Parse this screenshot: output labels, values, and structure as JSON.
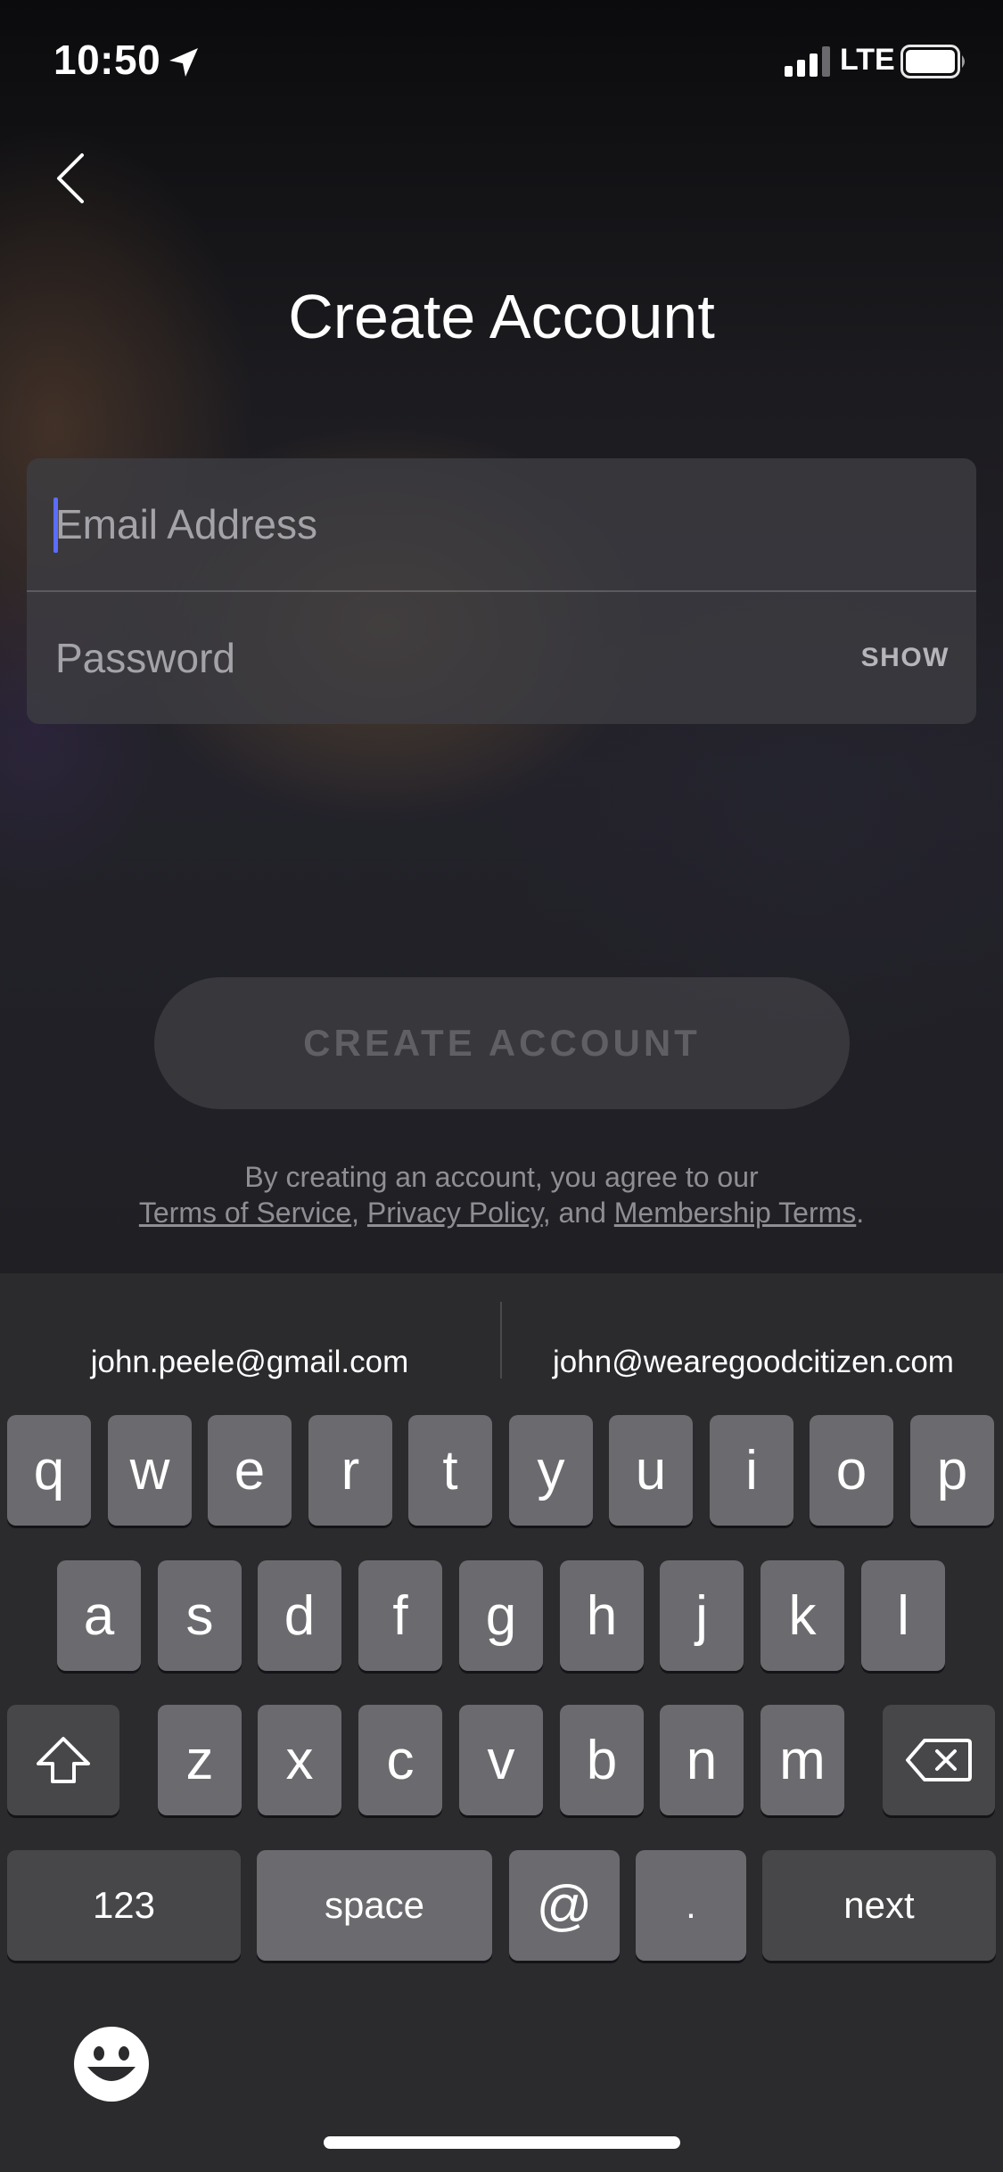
{
  "status_bar": {
    "time": "10:50",
    "network": "LTE",
    "icons": [
      "location-arrow-icon",
      "signal-icon",
      "battery-icon"
    ]
  },
  "header": {
    "back_icon": "chevron-left-icon",
    "title": "Create Account"
  },
  "form": {
    "email": {
      "placeholder": "Email Address",
      "value": ""
    },
    "password": {
      "placeholder": "Password",
      "value": "",
      "toggle_label": "SHOW"
    }
  },
  "create_button": {
    "label": "CREATE ACCOUNT",
    "enabled": false
  },
  "legal": {
    "intro": "By creating an account, you agree to our",
    "terms": "Terms of Service",
    "sep1": ", ",
    "privacy": "Privacy Policy",
    "sep2": ", and ",
    "membership": "Membership Terms",
    "end": "."
  },
  "keyboard": {
    "suggestions": [
      "john.peele@gmail.com",
      "john@wearegoodcitizen.com"
    ],
    "row1": [
      "q",
      "w",
      "e",
      "r",
      "t",
      "y",
      "u",
      "i",
      "o",
      "p"
    ],
    "row2": [
      "a",
      "s",
      "d",
      "f",
      "g",
      "h",
      "j",
      "k",
      "l"
    ],
    "row3": [
      "z",
      "x",
      "c",
      "v",
      "b",
      "n",
      "m"
    ],
    "row4": {
      "numbers": "123",
      "space": "space",
      "at": "@",
      "dot": ".",
      "next": "next"
    },
    "shift_icon": "shift-icon",
    "delete_icon": "backspace-icon",
    "emoji_icon": "emoji-icon"
  },
  "colors": {
    "accent_caret": "#5b6cff",
    "keyboard_bg": "#2b2b2e",
    "key_bg": "#6b6b6f",
    "key_dark_bg": "#474749"
  }
}
